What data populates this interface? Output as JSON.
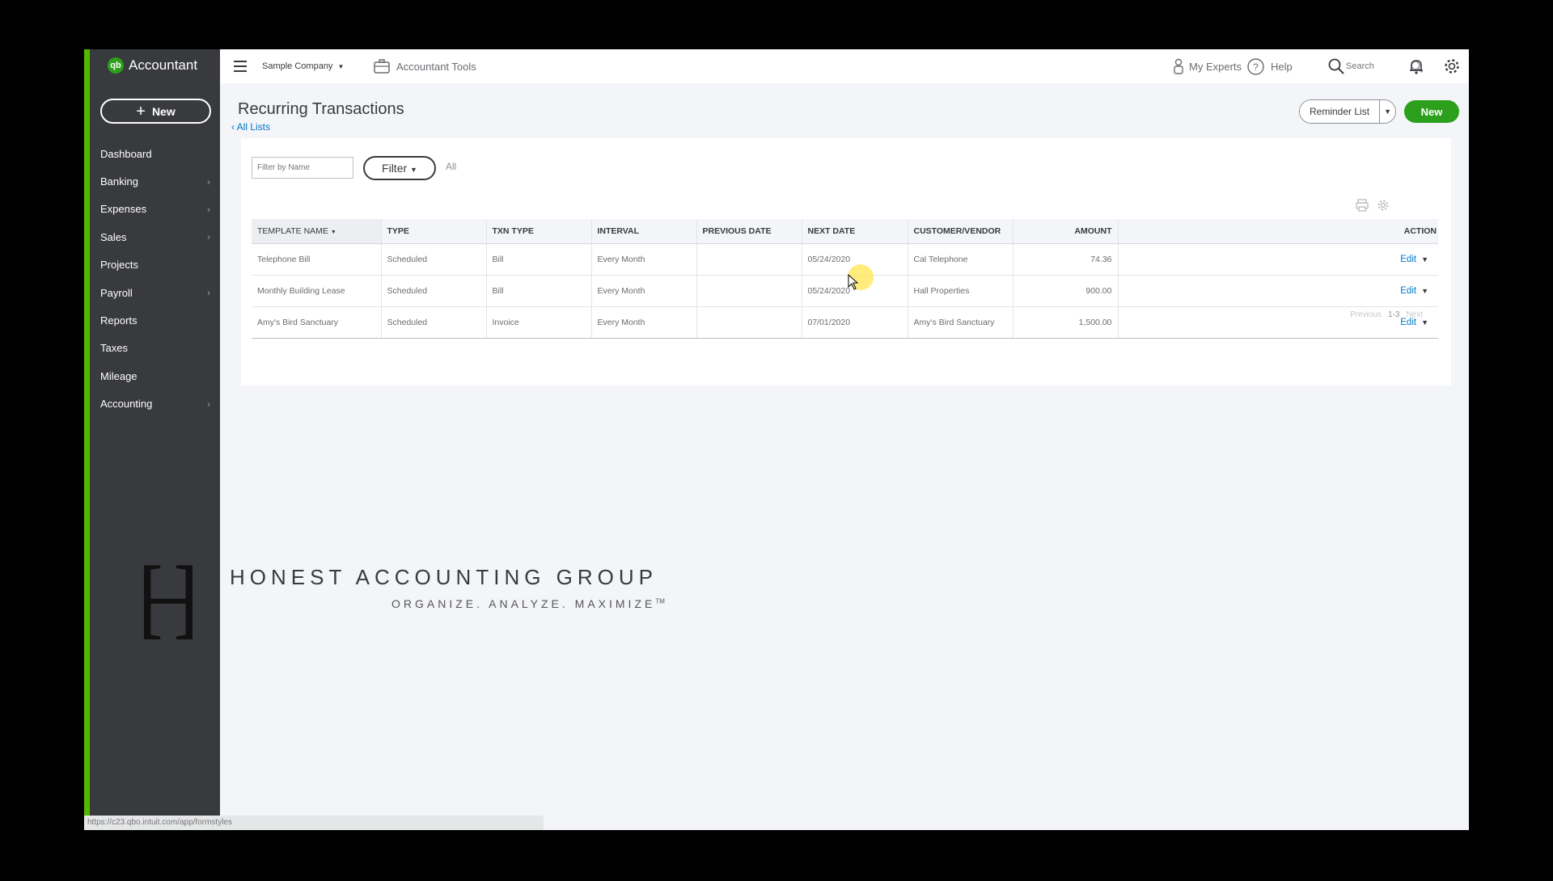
{
  "app": {
    "logo_text": "Accountant",
    "logo_mark": "qb",
    "new_button": "New"
  },
  "sidebar": {
    "items": [
      {
        "label": "Dashboard",
        "chevron": ""
      },
      {
        "label": "Banking",
        "chevron": "›"
      },
      {
        "label": "Expenses",
        "chevron": "›"
      },
      {
        "label": "Sales",
        "chevron": "›"
      },
      {
        "label": "Projects",
        "chevron": ""
      },
      {
        "label": "Payroll",
        "chevron": "›"
      },
      {
        "label": "Reports",
        "chevron": ""
      },
      {
        "label": "Taxes",
        "chevron": ""
      },
      {
        "label": "Mileage",
        "chevron": ""
      },
      {
        "label": "Accounting",
        "chevron": "›"
      }
    ]
  },
  "topbar": {
    "company": "Sample Company",
    "accountant_tools": "Accountant Tools",
    "my_experts": "My Experts",
    "help": "Help",
    "search_placeholder": "Search"
  },
  "header": {
    "title": "Recurring Transactions",
    "back_link": "All Lists",
    "reminder_list": "Reminder List",
    "new_button": "New"
  },
  "filters": {
    "name_placeholder": "Filter by Name",
    "filter_button": "Filter",
    "filter_value": "All"
  },
  "table": {
    "columns": [
      "TEMPLATE NAME",
      "TYPE",
      "TXN TYPE",
      "INTERVAL",
      "PREVIOUS DATE",
      "NEXT DATE",
      "CUSTOMER/VENDOR",
      "AMOUNT",
      "ACTION"
    ],
    "rows": [
      {
        "template_name": "Telephone Bill",
        "type": "Scheduled",
        "txn_type": "Bill",
        "interval": "Every Month",
        "previous_date": "",
        "next_date": "05/24/2020",
        "customer_vendor": "Cal Telephone",
        "amount": "74.36",
        "action": "Edit"
      },
      {
        "template_name": "Monthly Building Lease",
        "type": "Scheduled",
        "txn_type": "Bill",
        "interval": "Every Month",
        "previous_date": "",
        "next_date": "05/24/2020",
        "customer_vendor": "Hall Properties",
        "amount": "900.00",
        "action": "Edit"
      },
      {
        "template_name": "Amy's Bird Sanctuary",
        "type": "Scheduled",
        "txn_type": "Invoice",
        "interval": "Every Month",
        "previous_date": "",
        "next_date": "07/01/2020",
        "customer_vendor": "Amy's Bird Sanctuary",
        "amount": "1,500.00",
        "action": "Edit"
      }
    ]
  },
  "pagination": {
    "previous": "Previous",
    "range": "1-3",
    "next": "Next"
  },
  "watermark": {
    "letter": "H",
    "name": "HONEST ACCOUNTING GROUP",
    "tagline": "ORGANIZE. ANALYZE. MAXIMIZE",
    "tm": "TM"
  },
  "status_url": "https://c23.qbo.intuit.com/app/formstyles",
  "colors": {
    "brand_green": "#2ca01c",
    "sidebar_bg": "#393a3d",
    "sidebar_accent": "#53b700",
    "link_blue": "#0077c5"
  }
}
